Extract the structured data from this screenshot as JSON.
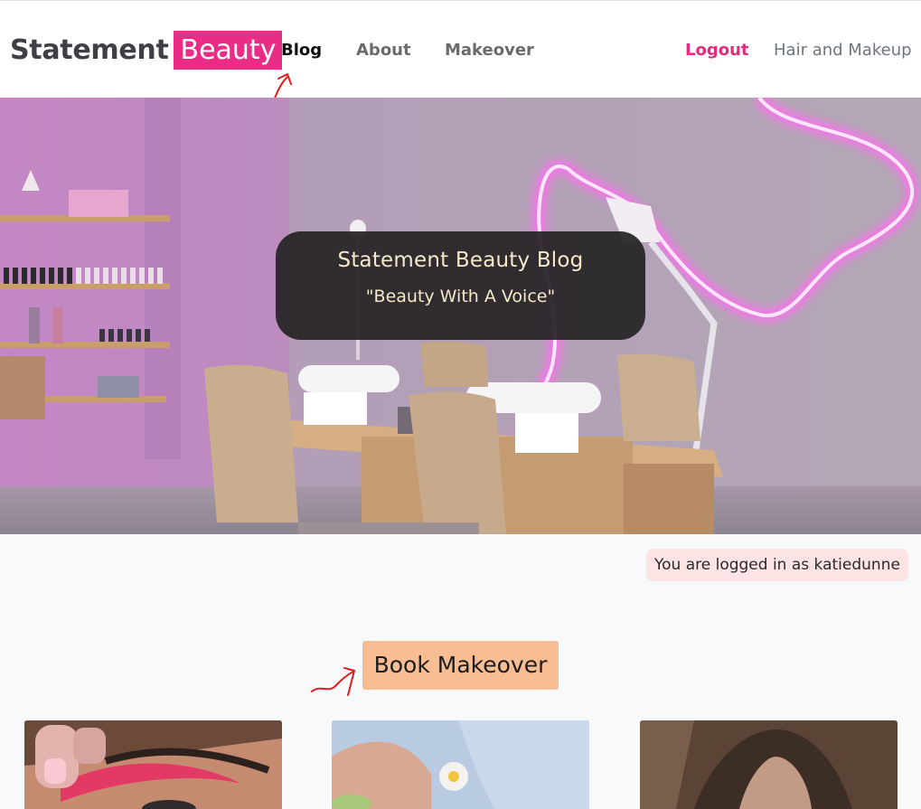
{
  "brand": {
    "name": "Statement",
    "accent": "Beauty",
    "accent_color": "#ea2c86"
  },
  "nav": {
    "blog": "Blog",
    "about": "About",
    "makeover": "Makeover",
    "logout": "Logout",
    "hair_makeup": "Hair and Makeup"
  },
  "hero": {
    "title": "Statement Beauty Blog",
    "subtitle": "\"Beauty With A Voice\""
  },
  "status": {
    "logged_in": "You are logged in as katiedunne"
  },
  "cta": {
    "book": "Book Makeover"
  },
  "colors": {
    "accent": "#ea2c86",
    "cta_bg": "#f9bd93",
    "badge_bg": "#fde4e4",
    "annotation": "#e01b1b"
  },
  "icons": {
    "annotation_arrow": "hand-drawn-red-arrow"
  }
}
